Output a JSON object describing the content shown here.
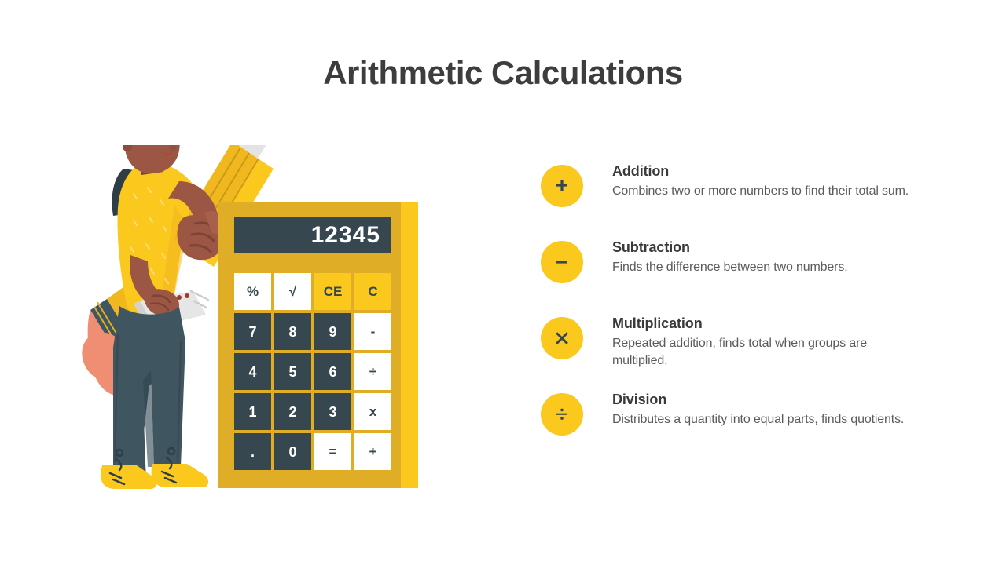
{
  "slide": {
    "title": "Arithmetic Calculations",
    "background_color": "#ffffff",
    "title_color": "#3d3d3d",
    "accent_color": "#fbc81d",
    "accent_dark_color": "#e0ae26",
    "dark_color": "#37474f"
  },
  "calculator": {
    "display_value": "12345",
    "keys": [
      {
        "label": "%",
        "style": "white",
        "name": "percent"
      },
      {
        "label": "√",
        "style": "white",
        "name": "square-root"
      },
      {
        "label": "CE",
        "style": "yellow",
        "name": "clear-entry"
      },
      {
        "label": "C",
        "style": "yellow",
        "name": "clear"
      },
      {
        "label": "7",
        "style": "dark",
        "name": "seven"
      },
      {
        "label": "8",
        "style": "dark",
        "name": "eight"
      },
      {
        "label": "9",
        "style": "dark",
        "name": "nine"
      },
      {
        "label": "-",
        "style": "white",
        "name": "minus"
      },
      {
        "label": "4",
        "style": "dark",
        "name": "four"
      },
      {
        "label": "5",
        "style": "dark",
        "name": "five"
      },
      {
        "label": "6",
        "style": "dark",
        "name": "six"
      },
      {
        "label": "÷",
        "style": "white",
        "name": "divide"
      },
      {
        "label": "1",
        "style": "dark",
        "name": "one"
      },
      {
        "label": "2",
        "style": "dark",
        "name": "two"
      },
      {
        "label": "3",
        "style": "dark",
        "name": "three"
      },
      {
        "label": "x",
        "style": "white",
        "name": "multiply"
      },
      {
        "label": ".",
        "style": "dark",
        "name": "decimal-point"
      },
      {
        "label": "0",
        "style": "dark",
        "name": "zero"
      },
      {
        "label": "=",
        "style": "white",
        "name": "equals"
      },
      {
        "label": "+",
        "style": "white",
        "name": "plus"
      }
    ]
  },
  "operations": [
    {
      "icon": "plus-icon",
      "title": "Addition",
      "description": "Combines two or more numbers to find their total sum."
    },
    {
      "icon": "minus-icon",
      "title": "Subtraction",
      "description": "Finds the difference between two numbers."
    },
    {
      "icon": "multiply-icon",
      "title": "Multiplication",
      "description": "Repeated addition, finds total when groups are multiplied."
    },
    {
      "icon": "divide-icon",
      "title": "Division",
      "description": "Distributes a quantity into equal parts, finds quotients."
    }
  ]
}
